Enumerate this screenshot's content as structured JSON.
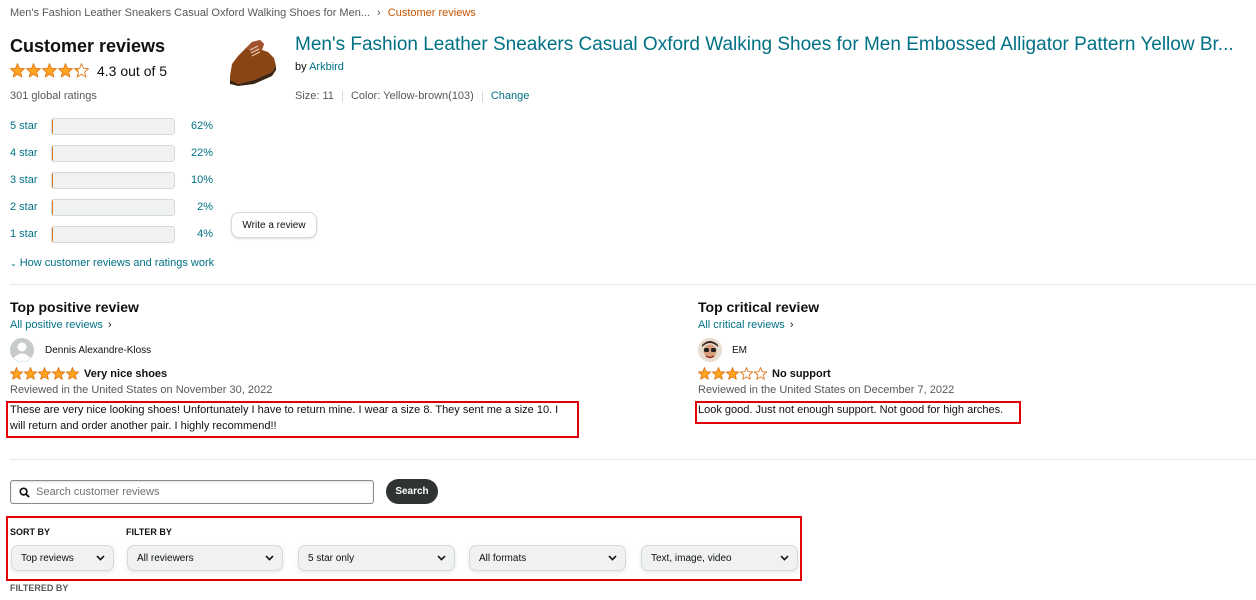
{
  "breadcrumb": {
    "product": "Men's Fashion Leather Sneakers Casual Oxford Walking Shoes for Men...",
    "separator": "›",
    "current": "Customer reviews"
  },
  "summary": {
    "title": "Customer reviews",
    "average_text": "4.3 out of 5",
    "average_value": 4.3,
    "global_ratings": "301 global ratings",
    "histogram": [
      {
        "label": "5 star",
        "percent_text": "62%",
        "percent": 62
      },
      {
        "label": "4 star",
        "percent_text": "22%",
        "percent": 22
      },
      {
        "label": "3 star",
        "percent_text": "10%",
        "percent": 10
      },
      {
        "label": "2 star",
        "percent_text": "2%",
        "percent": 2
      },
      {
        "label": "1 star",
        "percent_text": "4%",
        "percent": 4
      }
    ],
    "write_review_label": "Write a review",
    "how_link_label": "How customer reviews and ratings work"
  },
  "product": {
    "title": "Men's Fashion Leather Sneakers Casual Oxford Walking Shoes for Men Embossed Alligator Pattern Yellow Br...",
    "by_prefix": "by",
    "brand": "Arkbird",
    "size": "Size: 11",
    "color": "Color: Yellow-brown(103)",
    "change_label": "Change"
  },
  "top_positive": {
    "heading": "Top positive review",
    "all_link": "All positive reviews",
    "chevron": "›",
    "reviewer": "Dennis Alexandre-Kloss",
    "rating": 5,
    "title": "Very nice shoes",
    "date": "Reviewed in the United States on November 30, 2022",
    "body": "These are very nice looking shoes! Unfortunately I have to return mine. I wear a size 8. They sent me a size 10. I will return and order another pair. I highly recommend!!"
  },
  "top_critical": {
    "heading": "Top critical review",
    "all_link": "All critical reviews",
    "chevron": "›",
    "reviewer": "EM",
    "rating": 3,
    "title": "No support",
    "date": "Reviewed in the United States on December 7, 2022",
    "body": "Look good. Just not enough support. Not good for high arches."
  },
  "search": {
    "placeholder": "Search customer reviews",
    "value": "",
    "button_label": "Search"
  },
  "filters": {
    "sort_label": "SORT BY",
    "filter_label": "FILTER BY",
    "sort_value": "Top reviews",
    "reviewers_value": "All reviewers",
    "stars_value": "5 star only",
    "formats_value": "All formats",
    "media_value": "Text, image, video",
    "filtered_by_label": "FILTERED BY"
  },
  "colors": {
    "link": "#007185",
    "star": "#ffa41c",
    "highlight_box": "#e3000b",
    "breadcrumb_current": "#c45500"
  }
}
